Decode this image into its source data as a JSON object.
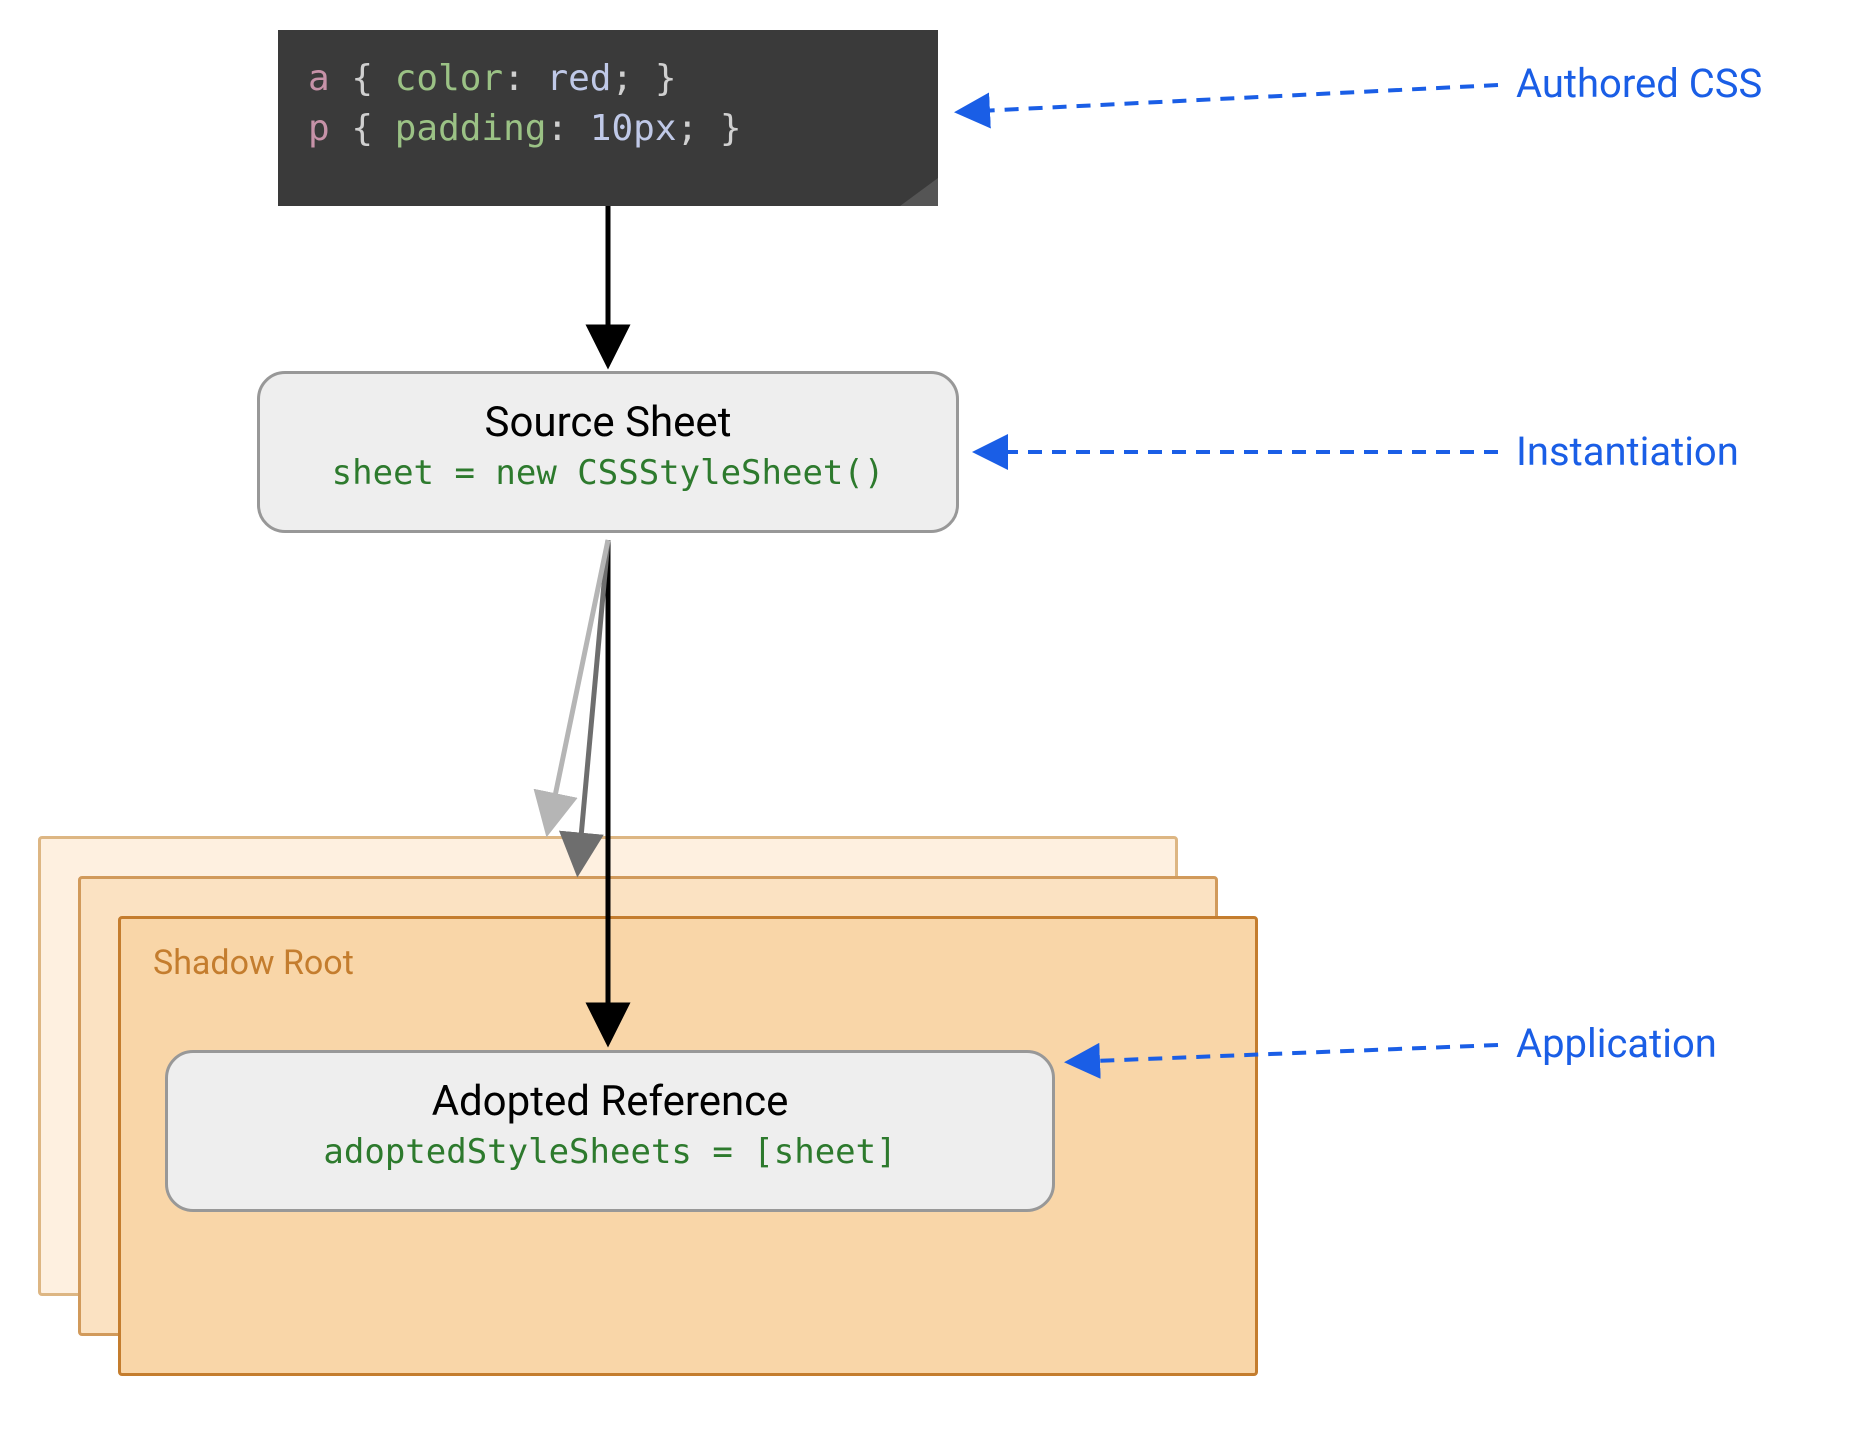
{
  "code_block": {
    "line1": {
      "selector": "a",
      "rule": "{ color: red; }",
      "property": "color",
      "value": "red"
    },
    "line2": {
      "selector": "p",
      "rule": "{ padding: 10px; }",
      "property": "padding",
      "value": "10px"
    }
  },
  "source_sheet": {
    "title": "Source Sheet",
    "code": "sheet = new CSSStyleSheet()"
  },
  "shadow_root": {
    "label": "Shadow Root"
  },
  "adopted_reference": {
    "title": "Adopted Reference",
    "code": "adoptedStyleSheets = [sheet]"
  },
  "annotations": {
    "authored": "Authored CSS",
    "instantiation": "Instantiation",
    "application": "Application"
  },
  "chart_data": {
    "type": "diagram",
    "description": "Flow diagram showing Constructable Stylesheets: Authored CSS -> Source Sheet (CSSStyleSheet instantiation) -> Shadow Root adoptedStyleSheets (Application)",
    "nodes": [
      {
        "id": "authored_css",
        "label": "Authored CSS",
        "content": "a { color: red; } p { padding: 10px; }"
      },
      {
        "id": "source_sheet",
        "label": "Source Sheet",
        "content": "sheet = new CSSStyleSheet()"
      },
      {
        "id": "shadow_root",
        "label": "Shadow Root",
        "content": "adoptedStyleSheets = [sheet]",
        "note": "Adopted Reference, stacked ×3"
      }
    ],
    "edges": [
      {
        "from": "authored_css",
        "to": "source_sheet",
        "label": "Instantiation"
      },
      {
        "from": "source_sheet",
        "to": "shadow_root",
        "label": "Application",
        "fanout": 3
      }
    ],
    "callouts": [
      {
        "target": "authored_css",
        "label": "Authored CSS"
      },
      {
        "target": "source_sheet",
        "label": "Instantiation"
      },
      {
        "target": "shadow_root",
        "label": "Application"
      }
    ]
  }
}
